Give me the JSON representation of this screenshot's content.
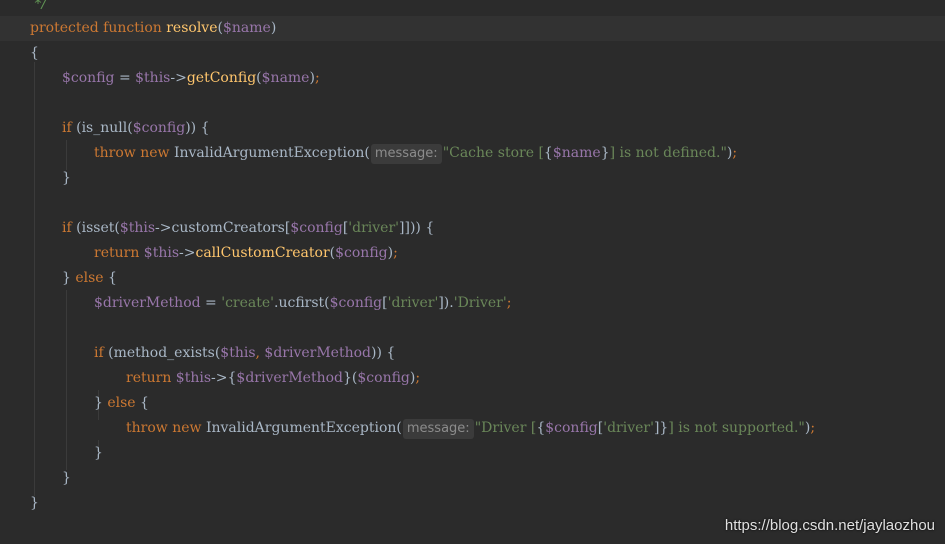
{
  "code": {
    "l0": {
      "comment": " */"
    },
    "l1": {
      "kw_protected": "protected",
      "kw_function": "function",
      "fn_name": "resolve",
      "open": "(",
      "param": "$name",
      "close": ")"
    },
    "l2": {
      "brace": "{"
    },
    "l3": {
      "var": "$config",
      "eq": " = ",
      "this": "$this",
      "arrow": "->",
      "fn": "getConfig",
      "open": "(",
      "arg": "$name",
      "close": ")",
      "semi": ";"
    },
    "l4": {
      "kw_if": "if",
      "pre": " (is_null(",
      "var": "$config",
      "post": ")) {"
    },
    "l5": {
      "kw_throw": "throw",
      "kw_new": "new",
      "cls": " InvalidArgumentException(",
      "hint": "message:",
      "str1": "\"Cache store [",
      "brace_open": "{",
      "var": "$name",
      "brace_close": "}",
      "str2": "] is not defined.\"",
      "close": ")",
      "semi": ";"
    },
    "l6": {
      "brace": "}"
    },
    "l7": {
      "kw_if": "if",
      "pre": " (",
      "fn_isset": "isset",
      "open": "(",
      "this": "$this",
      "arrow": "->",
      "prop": "customCreators[",
      "var": "$config",
      "bracket": "[",
      "str": "'driver'",
      "post": "]])) {"
    },
    "l8": {
      "kw_return": "return",
      "this": " $this",
      "arrow": "->",
      "fn": "callCustomCreator",
      "open": "(",
      "var": "$config",
      "close": ")",
      "semi": ";"
    },
    "l9": {
      "brace": "} ",
      "kw_else": "else",
      "post": " {"
    },
    "l10": {
      "var": "$driverMethod",
      "eq": " = ",
      "str1": "'create'",
      "dot1": ".",
      "fn": "ucfirst(",
      "var2": "$config",
      "bracket": "[",
      "str2": "'driver'",
      "close": "])",
      "dot2": ".",
      "str3": "'Driver'",
      "semi": ";"
    },
    "l11": {
      "kw_if": "if",
      "pre": " (method_exists(",
      "this": "$this",
      "comma": ", ",
      "var": "$driverMethod",
      "post": ")) {"
    },
    "l12": {
      "kw_return": "return",
      "this": " $this",
      "arrow": "->",
      "brace_open": "{",
      "var": "$driverMethod",
      "brace_close": "}",
      "open": "(",
      "var2": "$config",
      "close": ")",
      "semi": ";"
    },
    "l13": {
      "brace": "} ",
      "kw_else": "else",
      "post": " {"
    },
    "l14": {
      "kw_throw": "throw",
      "kw_new": "new",
      "cls": " InvalidArgumentException(",
      "hint": "message:",
      "str1": "\"Driver [",
      "brace_open": "{",
      "var": "$config",
      "bracket": "[",
      "str2": "'driver'",
      "brace_close": "]}",
      "str3": "] is not supported.\"",
      "close": ")",
      "semi": ";"
    },
    "l15": {
      "brace": "}"
    },
    "l16": {
      "brace": "}"
    },
    "l17": {
      "brace": "}"
    }
  },
  "watermark": "https://blog.csdn.net/jaylaozhou"
}
